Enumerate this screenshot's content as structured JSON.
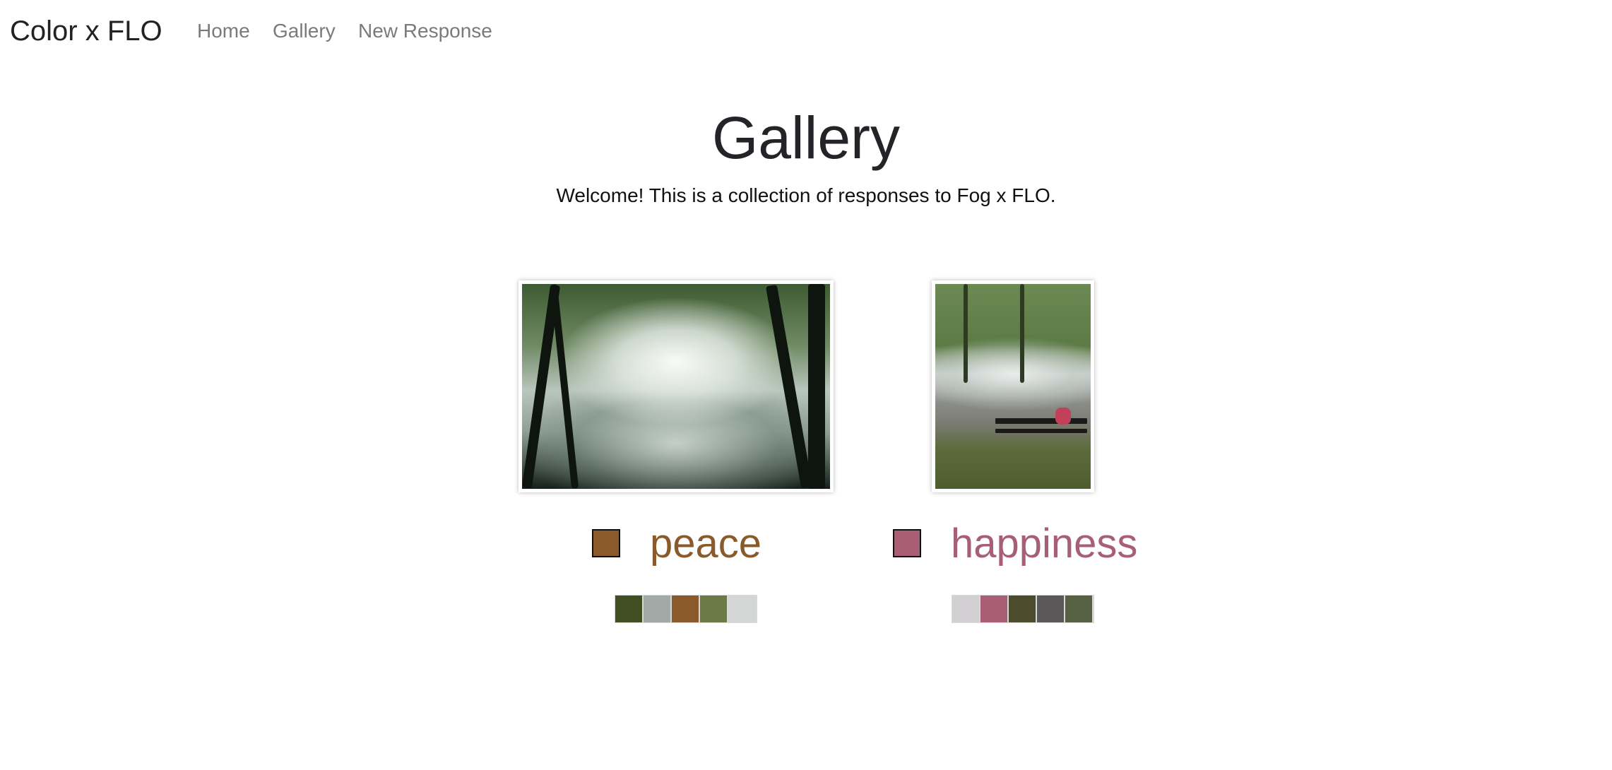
{
  "nav": {
    "brand": "Color x FLO",
    "links": [
      "Home",
      "Gallery",
      "New Response"
    ]
  },
  "header": {
    "title": "Gallery",
    "subtitle": "Welcome! This is a collection of responses to Fog x FLO."
  },
  "responses": [
    {
      "word": "peace",
      "color": "#8a5a2b",
      "palette": [
        "#3f4f22",
        "#a2aaa8",
        "#8a5a2b",
        "#6b7a46",
        "#d4d6d5"
      ]
    },
    {
      "word": "happiness",
      "color": "#a85e74",
      "palette": [
        "#d3d0d4",
        "#a85e74",
        "#4c4b2c",
        "#5a5859",
        "#566043"
      ]
    }
  ]
}
